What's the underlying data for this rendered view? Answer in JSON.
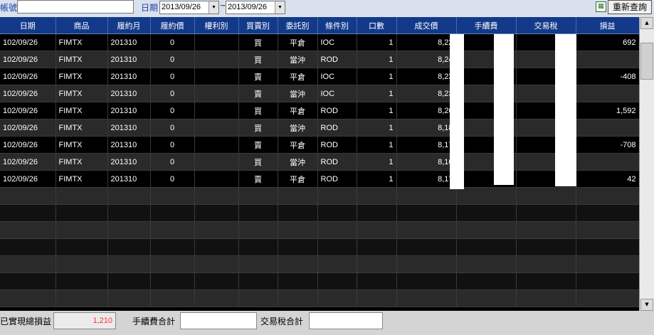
{
  "toolbar": {
    "account_label": "帳號",
    "account_value": "",
    "date_label": "日期",
    "date_from": "2013/09/26",
    "date_separator": "~",
    "date_to": "2013/09/26",
    "export_icon": "grid-export-icon",
    "requery_label": "重新查詢"
  },
  "table": {
    "columns": [
      "日期",
      "商品",
      "履約月",
      "履約價",
      "權利別",
      "買賣別",
      "委託別",
      "條件別",
      "口數",
      "成交價",
      "手續費",
      "交易稅",
      "損益"
    ],
    "rows": [
      {
        "date": "102/09/26",
        "product": "FIMTX",
        "month": "201310",
        "strike": "0",
        "right": "",
        "side": "買",
        "side_type": "buy",
        "order": "平倉",
        "cond": "IOC",
        "qty": "1",
        "price": "8,22",
        "fee": "",
        "tax": "",
        "pnl": "692",
        "pnl_type": "pos"
      },
      {
        "date": "102/09/26",
        "product": "FIMTX",
        "month": "201310",
        "strike": "0",
        "right": "",
        "side": "買",
        "side_type": "buy",
        "order": "當沖",
        "cond": "ROD",
        "qty": "1",
        "price": "8,24",
        "fee": "",
        "tax": "",
        "pnl": "",
        "pnl_type": ""
      },
      {
        "date": "102/09/26",
        "product": "FIMTX",
        "month": "201310",
        "strike": "0",
        "right": "",
        "side": "賣",
        "side_type": "sell",
        "order": "平倉",
        "cond": "IOC",
        "qty": "1",
        "price": "8,23",
        "fee": "",
        "tax": "",
        "pnl": "-408",
        "pnl_type": "neg"
      },
      {
        "date": "102/09/26",
        "product": "FIMTX",
        "month": "201310",
        "strike": "0",
        "right": "",
        "side": "賣",
        "side_type": "sell",
        "order": "當沖",
        "cond": "IOC",
        "qty": "1",
        "price": "8,23",
        "fee": "",
        "tax": "",
        "pnl": "",
        "pnl_type": ""
      },
      {
        "date": "102/09/26",
        "product": "FIMTX",
        "month": "201310",
        "strike": "0",
        "right": "",
        "side": "買",
        "side_type": "buy",
        "order": "平倉",
        "cond": "ROD",
        "qty": "1",
        "price": "8,20",
        "fee": "",
        "tax": "",
        "pnl": "1,592",
        "pnl_type": "pos"
      },
      {
        "date": "102/09/26",
        "product": "FIMTX",
        "month": "201310",
        "strike": "0",
        "right": "",
        "side": "買",
        "side_type": "buy",
        "order": "當沖",
        "cond": "ROD",
        "qty": "1",
        "price": "8,18",
        "fee": "",
        "tax": "",
        "pnl": "",
        "pnl_type": ""
      },
      {
        "date": "102/09/26",
        "product": "FIMTX",
        "month": "201310",
        "strike": "0",
        "right": "",
        "side": "賣",
        "side_type": "sell",
        "order": "平倉",
        "cond": "ROD",
        "qty": "1",
        "price": "8,17",
        "fee": "",
        "tax": "",
        "pnl": "-708",
        "pnl_type": "neg"
      },
      {
        "date": "102/09/26",
        "product": "FIMTX",
        "month": "201310",
        "strike": "0",
        "right": "",
        "side": "買",
        "side_type": "buy",
        "order": "當沖",
        "cond": "ROD",
        "qty": "1",
        "price": "8,16",
        "fee": "",
        "tax": "",
        "pnl": "",
        "pnl_type": ""
      },
      {
        "date": "102/09/26",
        "product": "FIMTX",
        "month": "201310",
        "strike": "0",
        "right": "",
        "side": "賣",
        "side_type": "sell",
        "order": "平倉",
        "cond": "ROD",
        "qty": "1",
        "price": "8,17",
        "fee": "",
        "tax": "",
        "pnl": "42",
        "pnl_type": "pos"
      }
    ]
  },
  "footer": {
    "realized_label": "已實現總損益",
    "realized_value": "1,210",
    "fee_label": "手續費合計",
    "fee_value": "",
    "tax_label": "交易稅合計",
    "tax_value": ""
  },
  "colors": {
    "header_bg": "#133a8a",
    "buy": "#ff3030",
    "sell": "#28d828"
  }
}
